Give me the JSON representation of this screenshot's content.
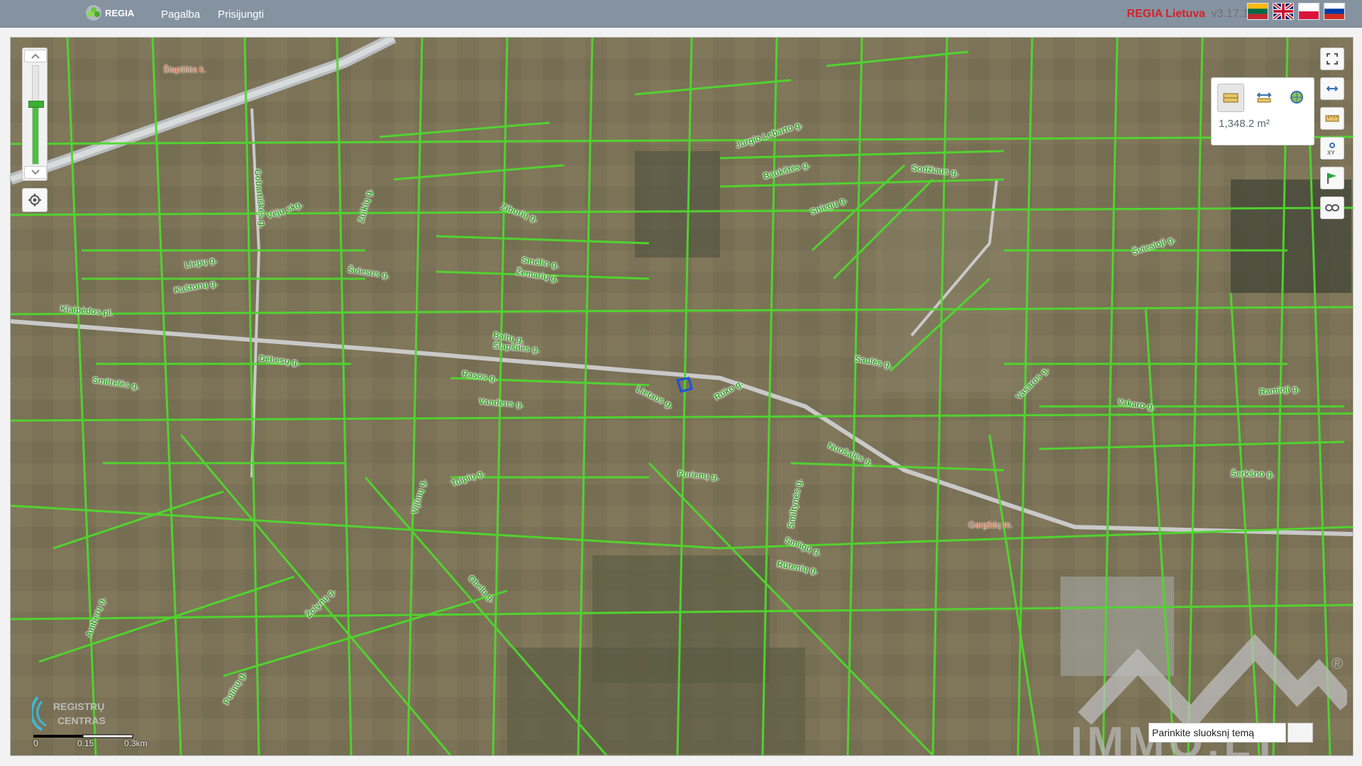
{
  "header": {
    "brand_text": "REGIA",
    "nav": [
      "Pagalba",
      "Prisijungti"
    ],
    "app_name": "REGIA Lietuva",
    "app_version": "v3.17.1",
    "languages": [
      "lt-flag",
      "en-flag",
      "pl-flag",
      "ru-flag"
    ]
  },
  "map": {
    "streets": [
      "Klaipėdos pl.",
      "Šlapšilės g.",
      "Smiltelės g.",
      "Dėbesų g.",
      "Rasos g.",
      "Vandens g.",
      "Lietaus g.",
      "Rūko g.",
      "Purienų g.",
      "Nuošalės g.",
      "Saulės g.",
      "Vasaros g.",
      "Vakaro g.",
      "Ramioji g.",
      "Šerkšno g.",
      "Šviesioji g.",
      "Sodžiaus g.",
      "Jurgio Lebarto g.",
      "Baukštės g.",
      "Sniegų g.",
      "Smiltynės g.",
      "Žiedų g.",
      "Liepų g.",
      "Kaštonų g.",
      "Šviesos g.",
      "Žemarių g.",
      "Smėlio g.",
      "Baltų g.",
      "Ziburių g.",
      "Gobartiškės g.",
      "Vėjų skg.",
      "Zuikių g.",
      "Amberų g.",
      "Obelų g.",
      "Smilgų g.",
      "Rūtenių g.",
      "Žolynų g.",
      "Vijūnų g.",
      "Tulpių g.",
      "Putinų g."
    ],
    "places": [
      "Šlapšilės k.",
      "Gargždų m."
    ],
    "attribution": "REGISTRŲ CENTRAS",
    "scale": [
      "0",
      "0.15",
      "0.3km"
    ],
    "selected_parcel_color": "#1f4fd6",
    "parcel_line_color": "#4fd82d"
  },
  "zoom": {
    "level_fraction": 0.6
  },
  "measure": {
    "tools": [
      "measure-area-icon",
      "measure-distance-icon",
      "measure-coordinates-icon"
    ],
    "value": "1,348.2 m²"
  },
  "tools_right": [
    "fullscreen-icon",
    "extent-icon",
    "ruler-icon",
    "xy-icon",
    "flag-icon",
    "link-icon"
  ],
  "layer_search": {
    "value": "Parinkite sluoksnį temą"
  },
  "watermark": {
    "text": "IMMO.LT",
    "mark": "®"
  }
}
